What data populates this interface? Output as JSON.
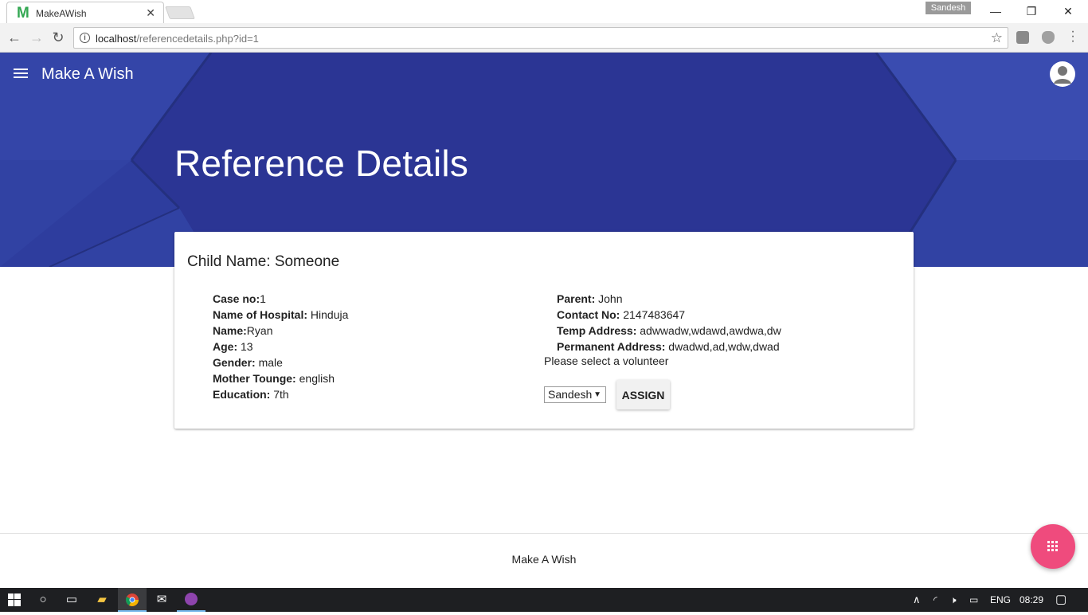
{
  "browser": {
    "tab_title": "MakeAWish",
    "tab_favicon": "M",
    "profile_name": "Sandesh",
    "url_host": "localhost",
    "url_path": "/referencedetails.php?id=1"
  },
  "header": {
    "brand": "Make A Wish",
    "page_title": "Reference Details"
  },
  "card": {
    "child_name": "Child Name: Someone",
    "left_fields": [
      {
        "label": "Case no:",
        "value": "1"
      },
      {
        "label": "Name of Hospital:",
        "value": " Hinduja"
      },
      {
        "label": "Name:",
        "value": "Ryan"
      },
      {
        "label": "Age:",
        "value": " 13"
      },
      {
        "label": "Gender:",
        "value": " male"
      },
      {
        "label": "Mother Tounge:",
        "value": " english"
      },
      {
        "label": "Education:",
        "value": " 7th"
      }
    ],
    "right_fields": [
      {
        "label": "Parent:",
        "value": " John"
      },
      {
        "label": "Contact No:",
        "value": " 2147483647"
      },
      {
        "label": "Temp Address:",
        "value": " adwwadw,wdawd,awdwa,dw"
      },
      {
        "label": "Permanent Address:",
        "value": " dwadwd,ad,wdw,dwad"
      }
    ],
    "volunteer_prompt": "Please select a volunteer",
    "volunteer_selected": "Sandesh",
    "assign_label": "ASSIGN"
  },
  "footer": {
    "text": "Make A Wish"
  },
  "taskbar": {
    "language": "ENG",
    "time": "08:29"
  },
  "colors": {
    "hero": "#2b3594",
    "fab": "#ef4b7d"
  }
}
